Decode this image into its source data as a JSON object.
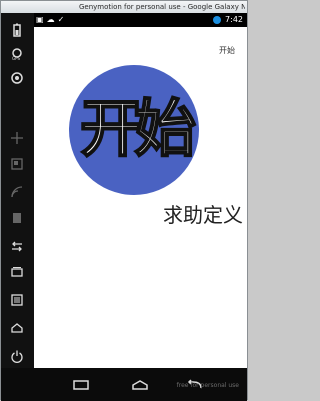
{
  "window": {
    "title": "Genymotion for personal use - Google Galaxy Nexus..."
  },
  "statusbar": {
    "left_items": [
      "▣",
      "☁",
      "✓"
    ],
    "time": "7:42"
  },
  "screen": {
    "corner_label": "开始",
    "circle_text": "开始",
    "caption": "求助定义"
  },
  "sidebar": {
    "icons": [
      "battery-icon",
      "gps-icon",
      "camera-icon",
      "move-icon",
      "id-icon",
      "rss-icon",
      "sd-card-icon",
      "back-icon",
      "recent-apps-icon",
      "menu-icon",
      "home-icon",
      "power-icon"
    ]
  },
  "nav": {
    "watermark": "free for personal use"
  }
}
